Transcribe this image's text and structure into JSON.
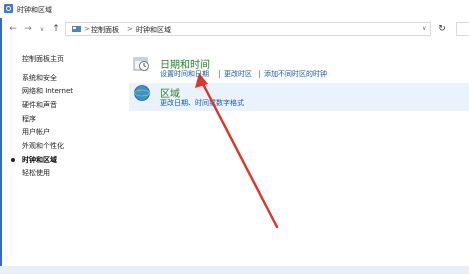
{
  "window": {
    "title": "时钟和区域"
  },
  "address_bar": {
    "crumbs": [
      "控制面板",
      "时钟和区域"
    ],
    "separator": ">"
  },
  "sidebar": {
    "items": [
      {
        "label": "控制面板主页"
      },
      {
        "label": "系统和安全"
      },
      {
        "label": "网络和 Internet"
      },
      {
        "label": "硬件和声音"
      },
      {
        "label": "程序"
      },
      {
        "label": "用户帐户"
      },
      {
        "label": "外观和个性化"
      },
      {
        "label": "时钟和区域",
        "selected": true
      },
      {
        "label": "轻松使用"
      }
    ]
  },
  "main": {
    "categories": [
      {
        "title": "日期和时间",
        "icon": "clock-calendar-icon",
        "links": [
          "设置时间和日期",
          "更改时区",
          "添加不同时区的时钟"
        ]
      },
      {
        "title": "区域",
        "icon": "globe-icon",
        "links": [
          "更改日期、时间或数字格式"
        ]
      }
    ]
  },
  "annotation": {
    "arrow_color": "#e0342a"
  },
  "colors": {
    "category_title": "#2a7e28",
    "link": "#1a56b0",
    "highlight": "#eaf3fb"
  }
}
